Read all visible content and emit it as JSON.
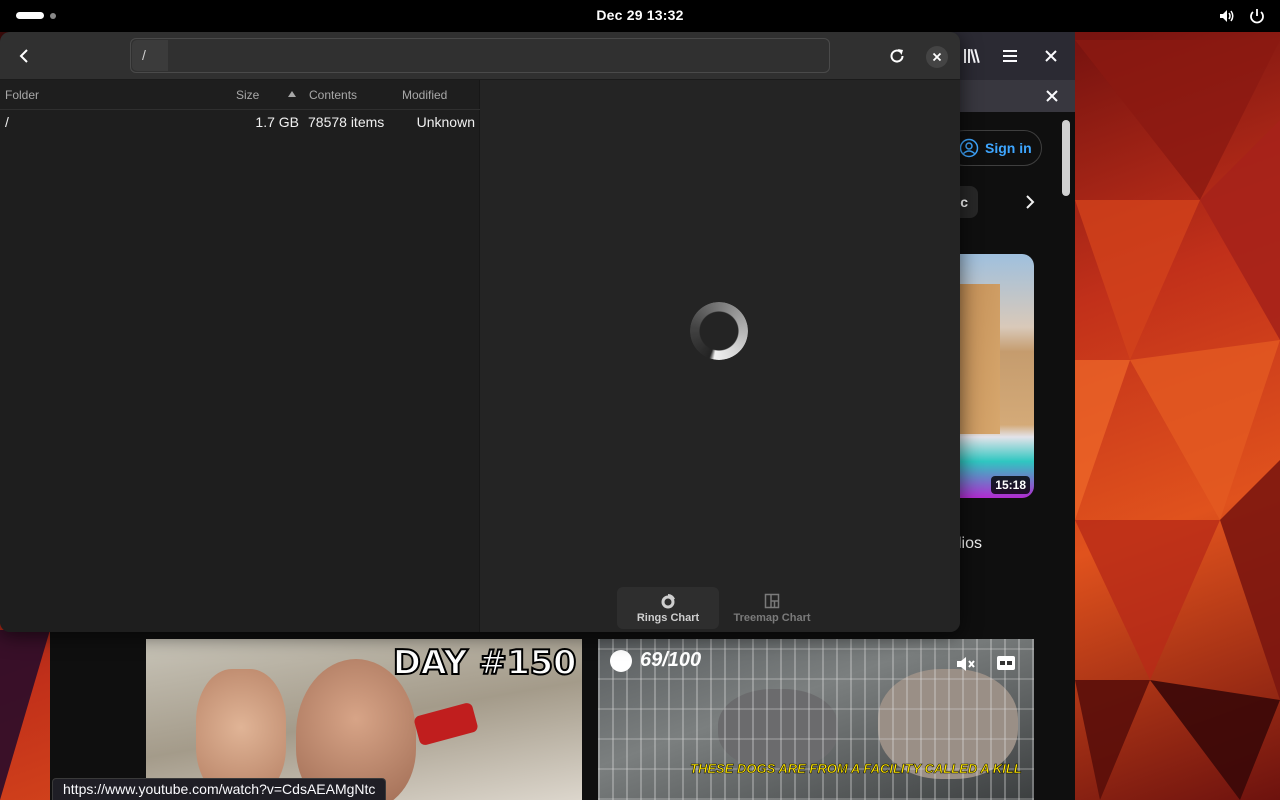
{
  "topbar": {
    "clock": "Dec 29  13:32",
    "icons": [
      "volume-icon",
      "power-icon"
    ]
  },
  "disk_analyzer": {
    "path": "/",
    "columns": {
      "folder": "Folder",
      "size": "Size",
      "contents": "Contents",
      "modified": "Modified"
    },
    "rows": [
      {
        "folder": "/",
        "size": "1.7 GB",
        "contents": "78578 items",
        "modified": "Unknown"
      }
    ],
    "sort": "size-ascending",
    "chart_modes": [
      {
        "label": "Rings Chart",
        "active": true
      },
      {
        "label": "Treemap Chart",
        "active": false
      }
    ],
    "loading": true
  },
  "browser": {
    "sign_in_label": "Sign in",
    "chip_label": "c",
    "video_duration": "15:18",
    "partial_title": "lios",
    "thumb1_overlay": "DAY #150",
    "thumb2_counter": "69/100",
    "thumb2_caption": "THESE DOGS ARE FROM A FACILITY CALLED A KILL",
    "status_url": "https://www.youtube.com/watch?v=CdsAEAMgNtc"
  },
  "colors": {
    "accent_link": "#3ea6ff",
    "window_bg": "#242424",
    "headerbar_bg": "#303030",
    "caption_yellow": "#ffe600"
  }
}
